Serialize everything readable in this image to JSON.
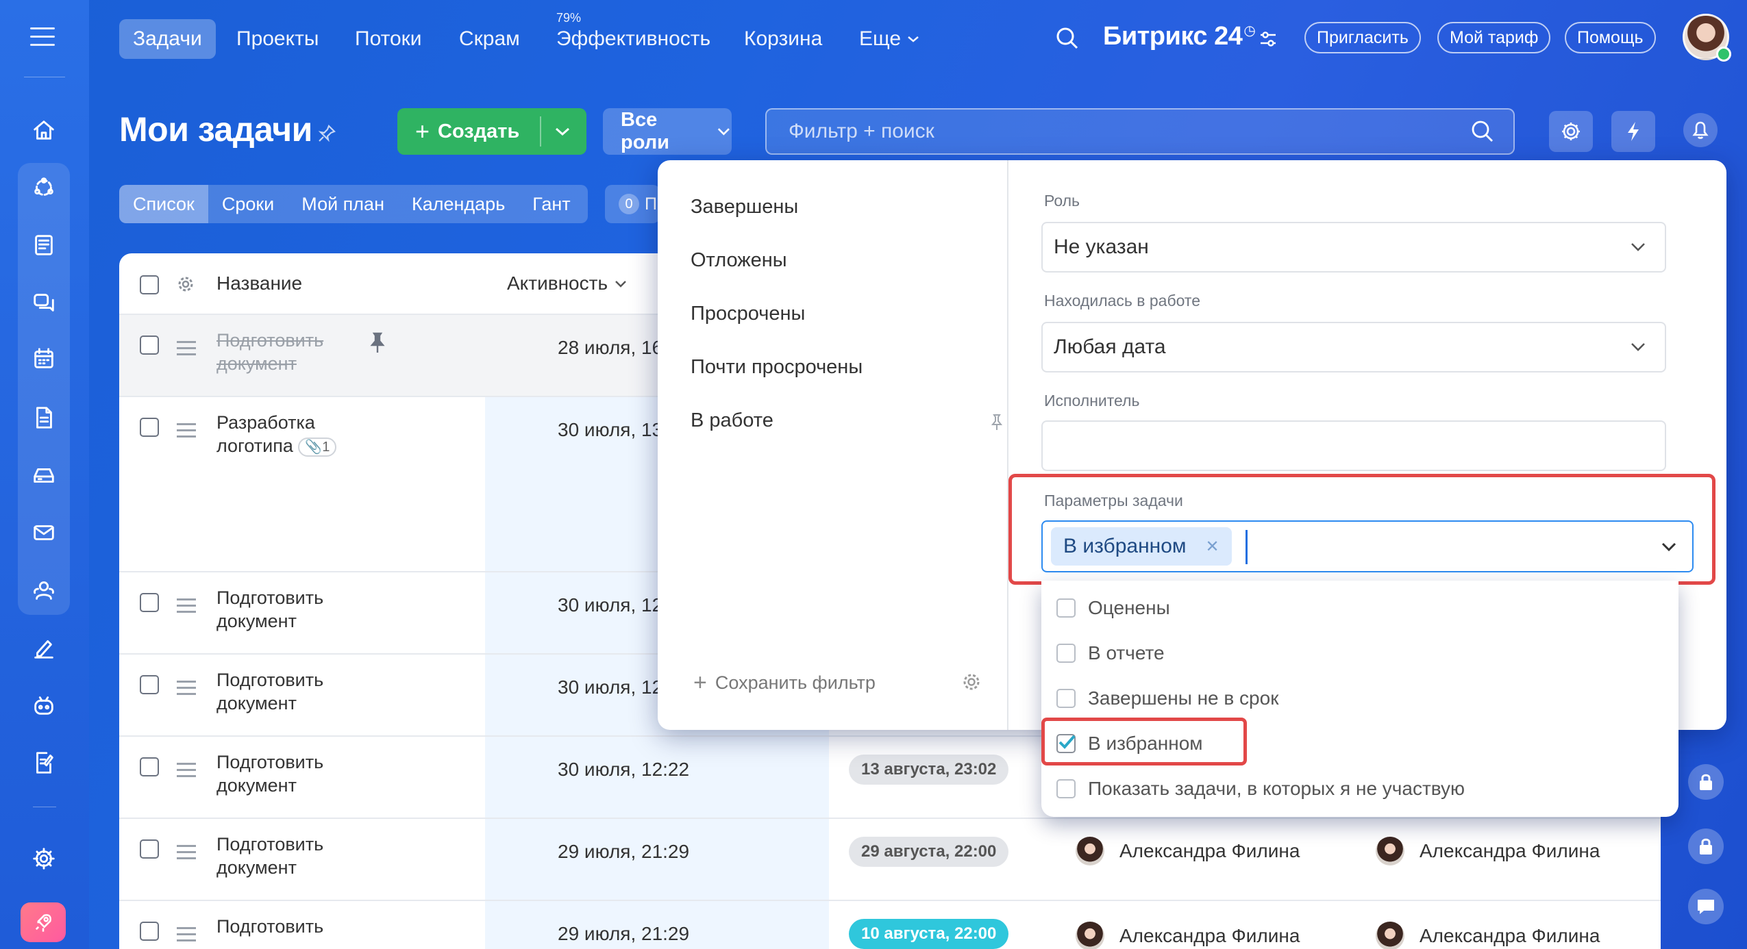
{
  "nav": {
    "tabs": [
      "Задачи",
      "Проекты",
      "Потоки",
      "Скрам",
      "Эффективность",
      "Корзина",
      "Еще"
    ],
    "efficiency_pct": "79%",
    "brand": "Битрикс 24",
    "invite": "Пригласить",
    "tariff": "Мой тариф",
    "help": "Помощь"
  },
  "header": {
    "title": "Мои задачи",
    "create": "Создать",
    "roles": "Все роли",
    "search_placeholder": "Фильтр + поиск"
  },
  "views": {
    "items": [
      "Список",
      "Сроки",
      "Мой план",
      "Календарь",
      "Гант"
    ],
    "counter": "0",
    "counter_tail": "П"
  },
  "table": {
    "col_name": "Название",
    "col_activity": "Активность",
    "rows": [
      {
        "name": "Подготовить документ",
        "date": "28 июля, 16",
        "deadline": "",
        "done": true
      },
      {
        "name": "Разработка логотипа",
        "attach": "1",
        "date": "30 июля, 13",
        "deadline": ""
      },
      {
        "name": "Подготовить документ",
        "date": "30 июля, 12",
        "deadline": ""
      },
      {
        "name": "Подготовить документ",
        "date": "30 июля, 12",
        "deadline": ""
      },
      {
        "name": "Подготовить документ",
        "date": "30 июля, 12:22",
        "deadline": "13 августа, 23:02"
      },
      {
        "name": "Подготовить документ",
        "date": "29 июля, 21:29",
        "deadline": "29 августа, 22:00",
        "person": "Александра Филина",
        "person2": "Александра Филина"
      },
      {
        "name": "Подготовить",
        "date": "29 июля, 21:29",
        "deadline": "10 августа, 22:00",
        "person": "Александра Филина",
        "person2": "Александра Филина"
      }
    ]
  },
  "filter": {
    "presets": [
      "Завершены",
      "Отложены",
      "Просрочены",
      "Почти просрочены",
      "В работе"
    ],
    "save": "Сохранить фильтр",
    "role_label": "Роль",
    "role_value": "Не указан",
    "worked_label": "Находилась в работе",
    "worked_value": "Любая дата",
    "assignee_label": "Исполнитель",
    "params_label": "Параметры задачи",
    "params_chip": "В избранном",
    "options": [
      {
        "label": "Оценены",
        "checked": false
      },
      {
        "label": "В отчете",
        "checked": false
      },
      {
        "label": "Завершены не в срок",
        "checked": false
      },
      {
        "label": "В избранном",
        "checked": true
      },
      {
        "label": "Показать задачи, в которых я не участвую",
        "checked": false
      }
    ]
  },
  "colors": {
    "accent": "#2d8bf0",
    "create": "#2fb362",
    "highlight": "#e24848",
    "teal_badge": "#2fc7dc"
  }
}
